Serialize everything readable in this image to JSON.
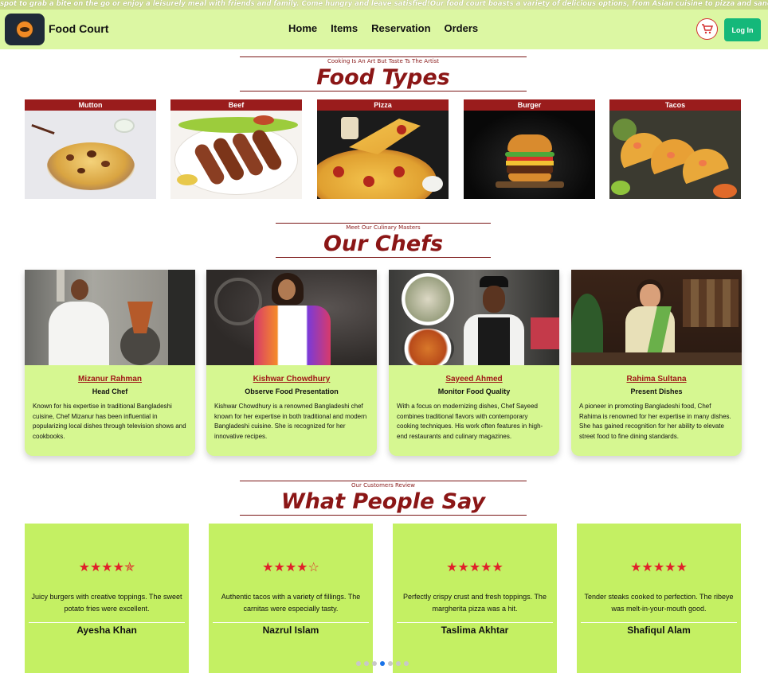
{
  "marquee": {
    "text": "spot to grab a bite on the go or enjoy a leisurely meal with friends and family. Come hungry and leave satisfied!Our food court boasts a variety of delicious options, from Asian cuisine to pizza and sandwiches. Wi"
  },
  "navbar": {
    "brand": "Food Court",
    "links": [
      "Home",
      "Items",
      "Reservation",
      "Orders"
    ],
    "login_label": "Log In",
    "cart_icon": "cart-icon"
  },
  "food_types": {
    "subtitle": "Cooking Is An Art But Taste Ts The Artist",
    "title": "Food Types",
    "items": [
      {
        "label": "Mutton"
      },
      {
        "label": "Beef"
      },
      {
        "label": "Pizza"
      },
      {
        "label": "Burger"
      },
      {
        "label": "Tacos"
      }
    ]
  },
  "chefs": {
    "subtitle": "Meet Our Culinary Masters",
    "title": "Our Chefs",
    "items": [
      {
        "name": "Mizanur Rahman",
        "role": "Head Chef",
        "bio": "Known for his expertise in traditional Bangladeshi cuisine, Chef Mizanur has been influential in popularizing local dishes through television shows and cookbooks."
      },
      {
        "name": "Kishwar Chowdhury",
        "role": "Observe Food Presentation",
        "bio": "Kishwar Chowdhury is a renowned Bangladeshi chef known for her expertise in both traditional and modern Bangladeshi cuisine. She is recognized for her innovative recipes."
      },
      {
        "name": "Sayeed Ahmed",
        "role": "Monitor Food Quality",
        "bio": "With a focus on modernizing dishes, Chef Sayeed combines traditional flavors with contemporary cooking techniques. His work often features in high-end restaurants and culinary magazines."
      },
      {
        "name": "Rahima Sultana",
        "role": "Present Dishes",
        "bio": "A pioneer in promoting Bangladeshi food, Chef Rahima is renowned for her expertise in many dishes. She has gained recognition for her ability to elevate street food to fine dining standards."
      }
    ]
  },
  "reviews": {
    "subtitle": "Our Customers Review",
    "title": "What People Say",
    "items": [
      {
        "rating": 4.5,
        "stars": "★★★★✯",
        "text": "Juicy burgers with creative toppings. The sweet potato fries were excellent.",
        "name": "Ayesha Khan"
      },
      {
        "rating": 4.5,
        "stars": "★★★★☆",
        "text": "Authentic tacos with a variety of fillings. The carnitas were especially tasty.",
        "name": "Nazrul Islam"
      },
      {
        "rating": 5,
        "stars": "★★★★★",
        "text": "Perfectly crispy crust and fresh toppings. The margherita pizza was a hit.",
        "name": "Taslima Akhtar"
      },
      {
        "rating": 5,
        "stars": "★★★★★",
        "text": "Tender steaks cooked to perfection. The ribeye was melt-in-your-mouth good.",
        "name": "Shafiqul Alam"
      }
    ],
    "carousel_dots": 7,
    "active_dot": 3
  },
  "colors": {
    "accent_red": "#8b1616",
    "nav_bg": "#dcf7a3",
    "chef_card_bg": "#d6f791",
    "review_card_bg": "#c4f063",
    "login_bg": "#14b87a"
  }
}
